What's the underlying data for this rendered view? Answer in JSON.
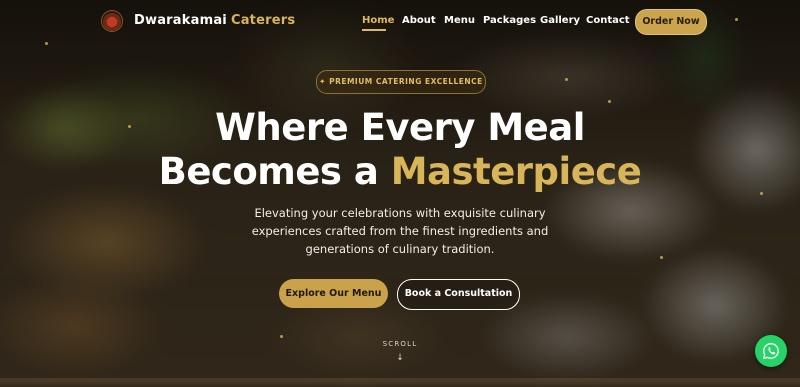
{
  "brand": {
    "name_primary": "Dwarakamai",
    "name_accent": "Caterers"
  },
  "nav": {
    "items": [
      {
        "label": "Home",
        "active": true
      },
      {
        "label": "About"
      },
      {
        "label": "Menu"
      },
      {
        "label": "Packages"
      },
      {
        "label": "Gallery"
      },
      {
        "label": "Contact"
      }
    ],
    "cta_label": "Order Now"
  },
  "hero": {
    "badge": "✦ PREMIUM CATERING EXCELLENCE",
    "title_line1": "Where Every Meal",
    "title_line2_prefix": "Becomes a",
    "title_line2_accent": "Masterpiece",
    "subtitle": "Elevating your celebrations with exquisite culinary experiences crafted from the finest ingredients and generations of culinary tradition.",
    "primary_button": "Explore Our Menu",
    "secondary_button": "Book a Consultation",
    "scroll_label": "SCROLL",
    "scroll_arrow": "↓"
  },
  "colors": {
    "accent_gold": "#d9b55a",
    "whatsapp_green": "#25d366"
  },
  "icons": {
    "logo": "restaurant-logo-icon",
    "whatsapp": "whatsapp-icon"
  }
}
